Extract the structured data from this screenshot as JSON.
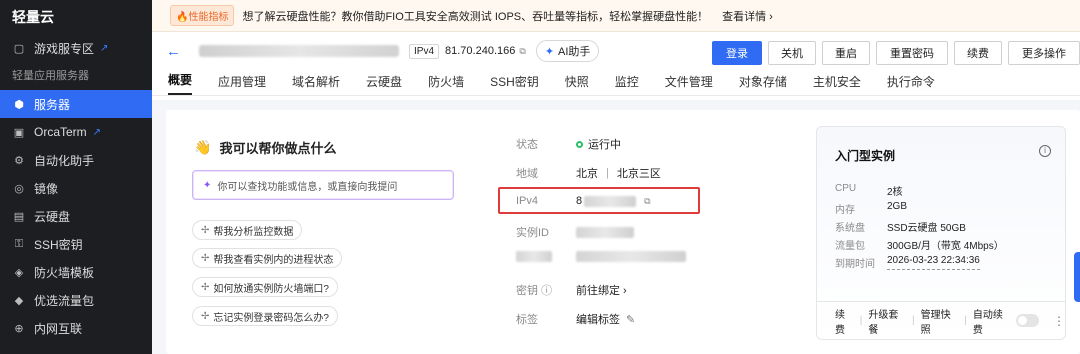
{
  "sidebar": {
    "brand": "轻量云",
    "items": [
      {
        "label": "游戏服专区",
        "icon": "gamepad-icon",
        "glyph": "▢",
        "external": true
      },
      {
        "section": "轻量应用服务器"
      },
      {
        "label": "服务器",
        "icon": "cube-icon",
        "glyph": "⬢",
        "active": true
      },
      {
        "label": "OrcaTerm",
        "icon": "terminal-icon",
        "glyph": "▣",
        "external": true
      },
      {
        "label": "自动化助手",
        "icon": "automation-icon",
        "glyph": "⚙"
      },
      {
        "label": "镜像",
        "icon": "image-icon",
        "glyph": "◎"
      },
      {
        "label": "云硬盘",
        "icon": "disk-icon",
        "glyph": "▤"
      },
      {
        "label": "SSH密钥",
        "icon": "key-icon",
        "glyph": "⚿"
      },
      {
        "label": "防火墙模板",
        "icon": "firewall-icon",
        "glyph": "◈"
      },
      {
        "label": "优选流量包",
        "icon": "traffic-icon",
        "glyph": "◆"
      },
      {
        "label": "内网互联",
        "icon": "network-icon",
        "glyph": "⊕"
      }
    ]
  },
  "notice": {
    "tag": "🔥性能指标",
    "text": "想了解云硬盘性能？教你借助FIO工具安全高效测试 IOPS、吞吐量等指标，轻松掌握硬盘性能！",
    "more": "查看详情 ›"
  },
  "header": {
    "back": "←",
    "ipv4_tag": "IPv4",
    "ip": "81.70.240.166",
    "ai_label": "AI助手"
  },
  "actions": [
    "登录",
    "关机",
    "重启",
    "重置密码",
    "续费",
    "更多操作"
  ],
  "tabs": [
    "概要",
    "应用管理",
    "域名解析",
    "云硬盘",
    "防火墙",
    "SSH密钥",
    "快照",
    "监控",
    "文件管理",
    "对象存储",
    "主机安全",
    "执行命令"
  ],
  "assistant": {
    "title": "我可以帮你做点什么",
    "placeholder": "你可以查找功能或信息，或直接向我提问",
    "chips": [
      "帮我分析监控数据",
      "帮我查看实例内的进程状态",
      "如何放通实例防火墙端口?",
      "忘记实例登录密码怎么办?"
    ]
  },
  "info": {
    "status_label": "状态",
    "status_value": "运行中",
    "region_label": "地域",
    "region_value": "北京",
    "zone_value": "北京三区",
    "ipv4_label": "IPv4",
    "ipv4_prefix": "8",
    "instance_label": "实例ID",
    "key_label": "密钥",
    "key_action": "前往绑定 ›",
    "tag_label": "标签",
    "tag_action": "编辑标签"
  },
  "spec": {
    "title": "入门型实例",
    "rows": [
      {
        "k": "CPU",
        "v": "2核"
      },
      {
        "k": "内存",
        "v": "2GB"
      },
      {
        "k": "系统盘",
        "v": "SSD云硬盘 50GB"
      },
      {
        "k": "流量包",
        "v": "300GB/月（带宽 4Mbps）"
      },
      {
        "k": "到期时间",
        "v": "2026-03-23 22:34:36"
      }
    ],
    "footer": [
      "续费",
      "升级套餐",
      "管理快照",
      "自动续费"
    ]
  },
  "colors": {
    "accent": "#2f6bf3",
    "highlight": "#e03b3b",
    "running": "#2bbf6a"
  }
}
